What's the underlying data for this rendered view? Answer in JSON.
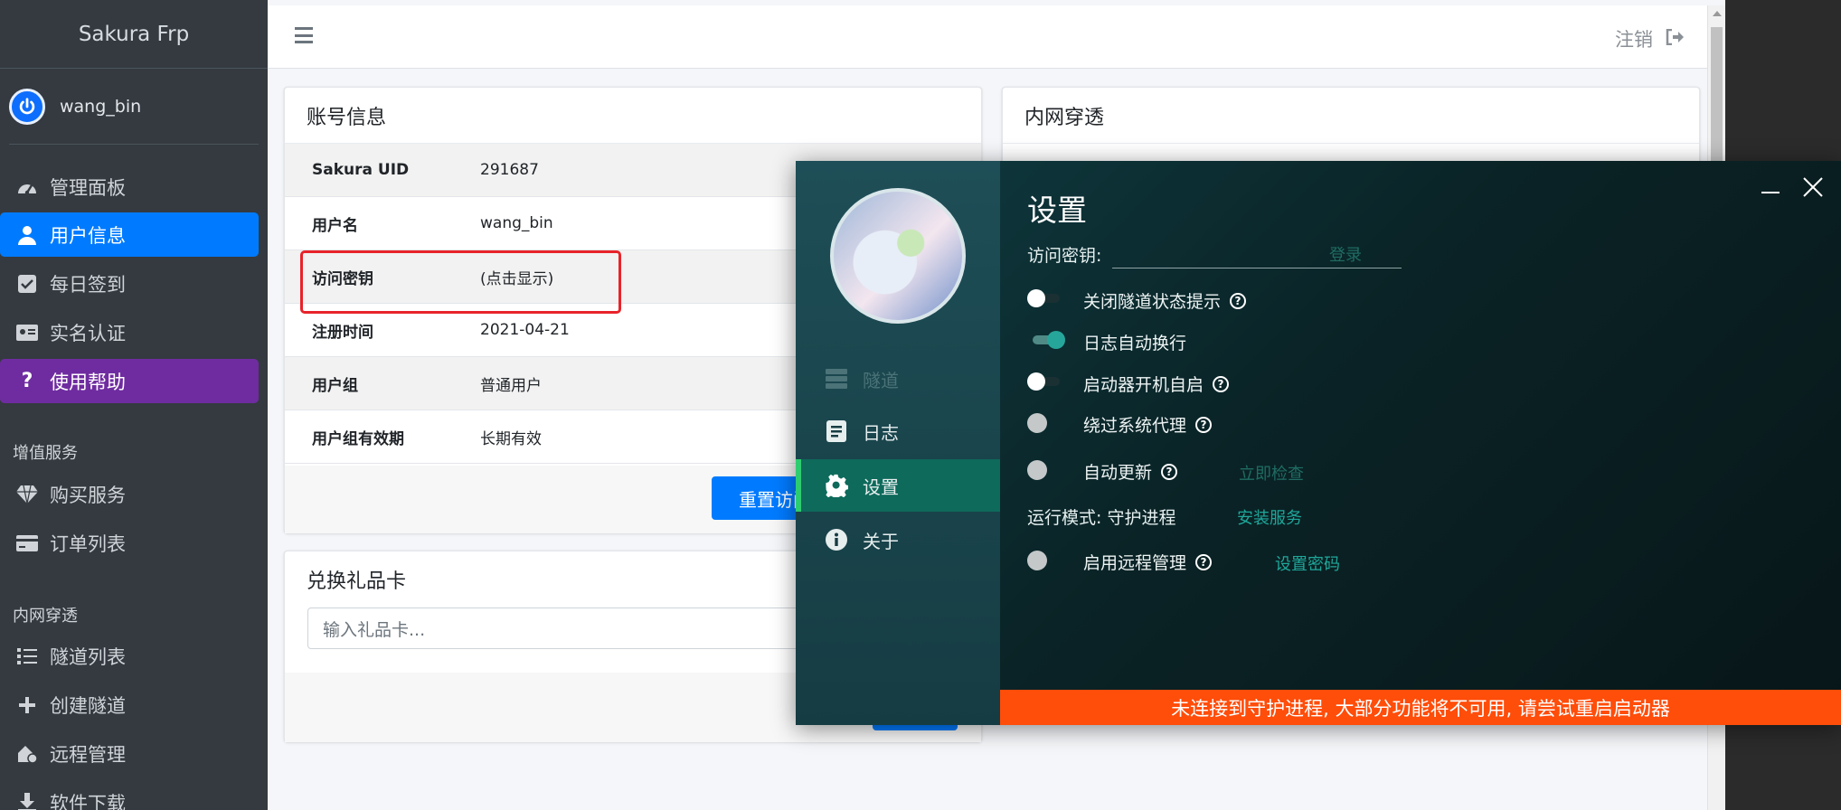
{
  "sidebar": {
    "brand": "Sakura Frp",
    "username": "wang_bin",
    "items": [
      {
        "label": "管理面板",
        "icon": "dashboard-icon"
      },
      {
        "label": "用户信息",
        "icon": "user-icon"
      },
      {
        "label": "每日签到",
        "icon": "check-square-icon"
      },
      {
        "label": "实名认证",
        "icon": "id-card-icon"
      },
      {
        "label": "使用帮助",
        "icon": "question-icon"
      }
    ],
    "section_value_added": "增值服务",
    "value_items": [
      {
        "label": "购买服务",
        "icon": "diamond-icon"
      },
      {
        "label": "订单列表",
        "icon": "credit-card-icon"
      }
    ],
    "section_tunnel": "内网穿透",
    "tunnel_items": [
      {
        "label": "隧道列表",
        "icon": "list-icon"
      },
      {
        "label": "创建隧道",
        "icon": "plus-icon"
      },
      {
        "label": "远程管理",
        "icon": "remote-icon"
      },
      {
        "label": "软件下载",
        "icon": "download-icon"
      }
    ]
  },
  "header": {
    "logout_label": "注销"
  },
  "account_card": {
    "title": "账号信息",
    "rows": [
      {
        "label": "Sakura UID",
        "value": "291687"
      },
      {
        "label": "用户名",
        "value": "wang_bin"
      },
      {
        "label": "访问密钥",
        "value": "(点击显示)"
      },
      {
        "label": "注册时间",
        "value": "2021-04-21"
      },
      {
        "label": "用户组",
        "value": "普通用户"
      },
      {
        "label": "用户组有效期",
        "value": "长期有效"
      }
    ],
    "reset_button": "重置访问"
  },
  "tunnel_card": {
    "title": "内网穿透"
  },
  "gift_card": {
    "title": "兑换礼品卡",
    "placeholder": "输入礼品卡..."
  },
  "launcher": {
    "nav": [
      {
        "label": "隧道",
        "icon": "server-icon"
      },
      {
        "label": "日志",
        "icon": "document-icon"
      },
      {
        "label": "设置",
        "icon": "gear-icon"
      },
      {
        "label": "关于",
        "icon": "info-icon"
      }
    ],
    "settings": {
      "title": "设置",
      "key_label": "访问密钥:",
      "login_link": "登录",
      "options": [
        {
          "label": "关闭隧道状态提示",
          "state": "off"
        },
        {
          "label": "日志自动换行",
          "state": "on"
        },
        {
          "label": "启动器开机自启",
          "state": "off"
        },
        {
          "label": "绕过系统代理",
          "state": "disabled"
        },
        {
          "label": "自动更新",
          "state": "disabled",
          "link": "立即检查"
        }
      ],
      "run_mode_label": "运行模式: 守护进程",
      "install_service_link": "安装服务",
      "remote_label": "启用远程管理",
      "set_password_link": "设置密码"
    },
    "banner": "未连接到守护进程, 大部分功能将不可用, 请尝试重启启动器",
    "colors": {
      "accent": "#26a69a",
      "banner": "#ff4d0a"
    }
  }
}
